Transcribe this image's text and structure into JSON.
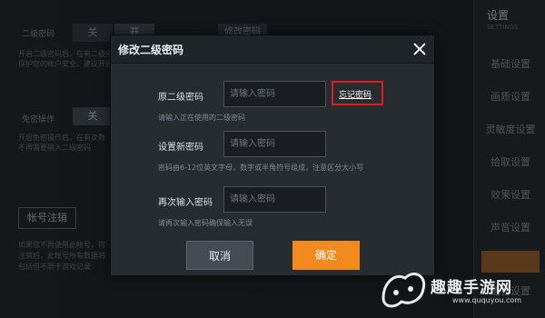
{
  "background": {
    "rows": [
      {
        "label": "二级密码",
        "toggle_off": "关",
        "toggle_on": "开",
        "fragment": "修改密码"
      },
      {
        "label": "免密操作",
        "toggle_off": "关",
        "toggle_on": "开"
      }
    ],
    "hints": [
      "开启二级密码后，在有二级密码",
      "保护您的帐户安全，建议开启",
      "开启免密操作后，在有次数",
      "不再需要输入二级密码"
    ],
    "account_button": "帐号注销",
    "bottom_hints": [
      "如果您不再使用此帐号，可",
      "注销后，此帐号所有数据将",
      "包括但不限于游戏记录"
    ],
    "sidebar": {
      "title": "设置",
      "subtitle": "SETTINGS",
      "items": [
        "基础设置",
        "画质设置",
        "灵敏度设置",
        "拾取设置",
        "效果设置",
        "声音设置",
        "语言设置"
      ]
    }
  },
  "modal": {
    "title": "修改二级密码",
    "close_icon": "close-icon",
    "fields": [
      {
        "label": "原二级密码",
        "placeholder": "请输入密码",
        "hint": "请输入正在使用的二级密码"
      },
      {
        "label": "设置新密码",
        "placeholder": "请输入密码",
        "hint": "密码由6-12位英文字母，数字或半角符号组成，注意区分大小写"
      },
      {
        "label": "再次输入密码",
        "placeholder": "请输入密码",
        "hint": "请再次输入密码确保输入无误"
      }
    ],
    "forgot_link": "忘记密码",
    "cancel_label": "取消",
    "confirm_label": "确定",
    "colors": {
      "confirm": "#f28a20",
      "highlight": "#e21b1b"
    }
  },
  "watermark": {
    "text": "趣趣手游网",
    "url": "www.ququyou.com"
  }
}
